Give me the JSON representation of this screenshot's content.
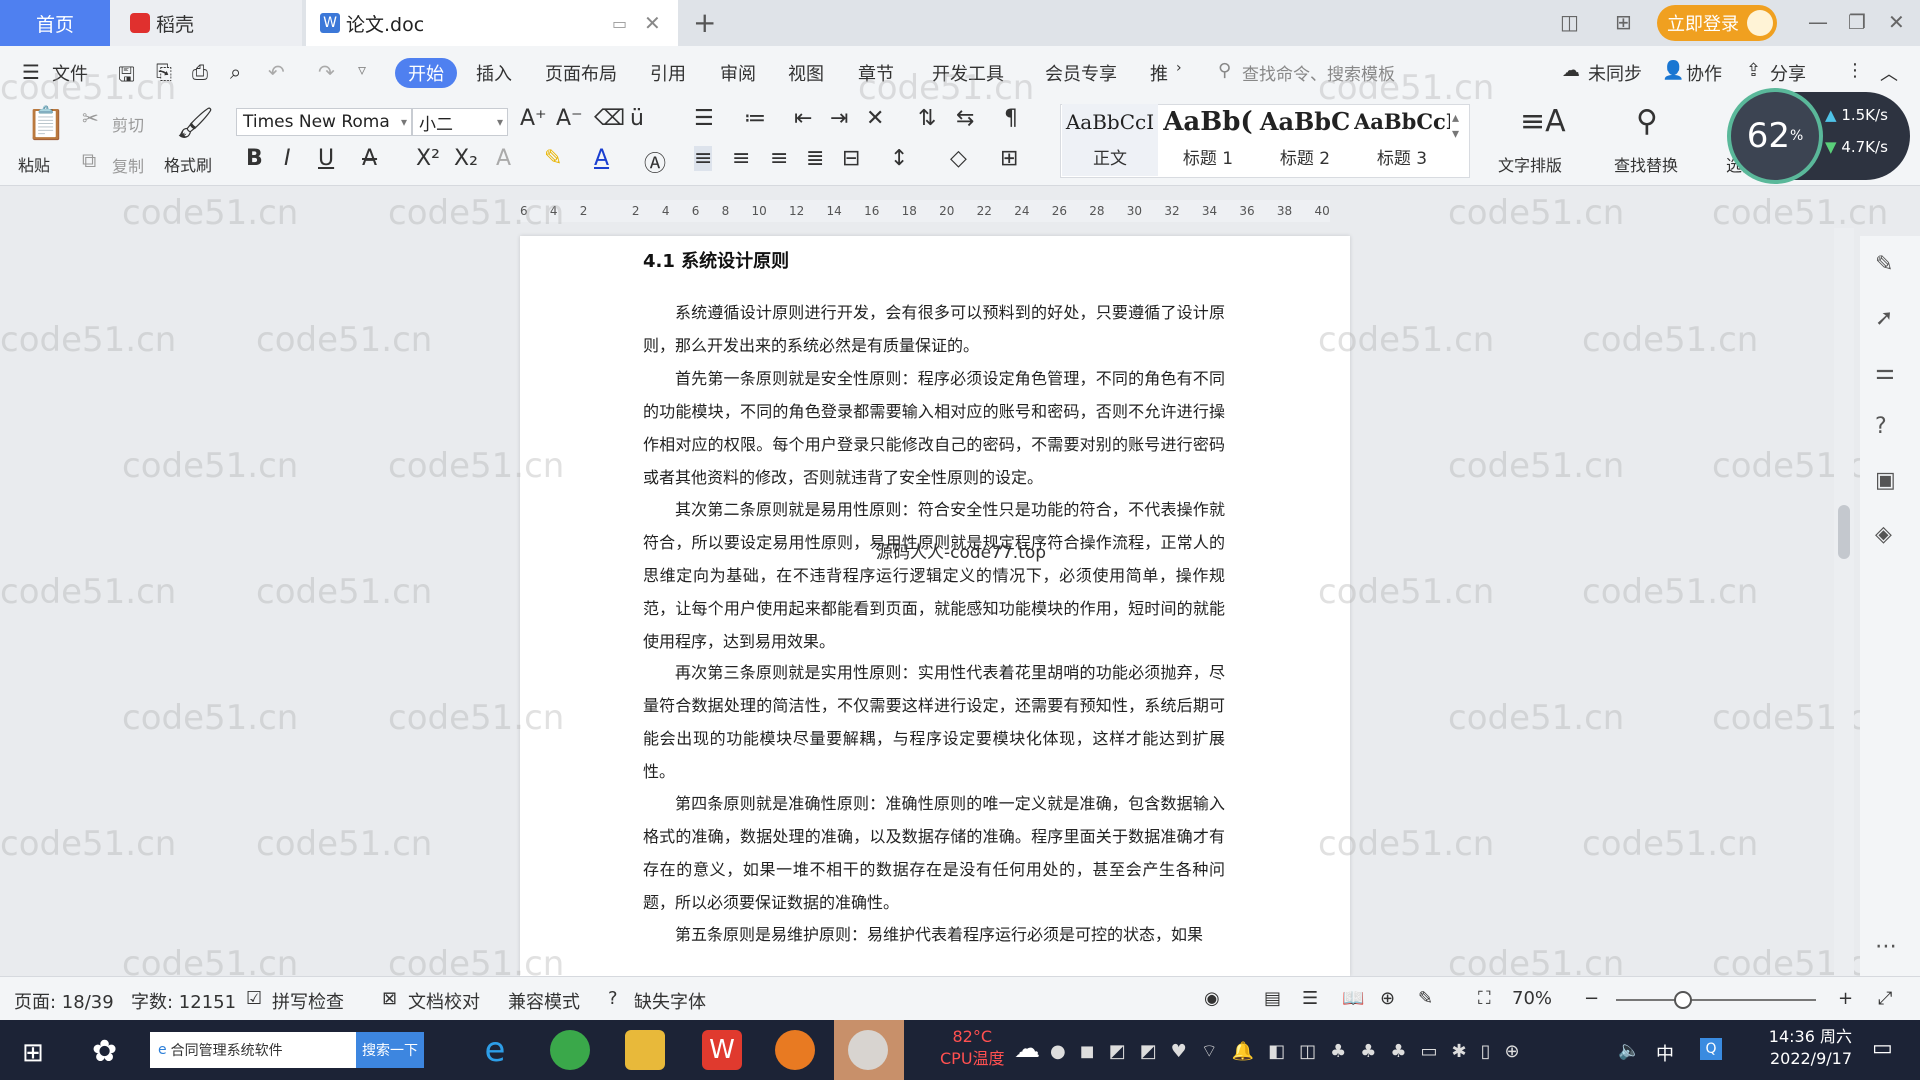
{
  "tabs": {
    "home": "首页",
    "daoke": "稻壳",
    "doc": "论文.doc",
    "new_tab": "+"
  },
  "title_bar": {
    "login": "立即登录"
  },
  "menu": {
    "file": "文件",
    "items": [
      "开始",
      "插入",
      "页面布局",
      "引用",
      "审阅",
      "视图",
      "章节",
      "开发工具",
      "会员专享",
      "推"
    ],
    "search_cmd": "查找命令、搜索模板",
    "sync": "未同步",
    "collab": "协作",
    "share": "分享"
  },
  "toolbar": {
    "paste": "粘贴",
    "cut": "剪切",
    "copy": "复制",
    "format_painter": "格式刷",
    "font_name": "Times New Roma",
    "font_size": "小二",
    "styles": [
      {
        "sample": "AaBbCcI",
        "name": "正文"
      },
      {
        "sample": "AaBb(",
        "name": "标题 1"
      },
      {
        "sample": "AaBbC",
        "name": "标题 2"
      },
      {
        "sample": "AaBbCcI",
        "name": "标题 3"
      }
    ],
    "text_layout": "文字排版",
    "find_replace": "查找替换",
    "select": "选择"
  },
  "speed_widget": {
    "percent": "62",
    "up": "1.5K/s",
    "down": "4.7K/s"
  },
  "ruler_ticks": [
    "6",
    "4",
    "2",
    "",
    "2",
    "4",
    "6",
    "8",
    "10",
    "12",
    "14",
    "16",
    "18",
    "20",
    "22",
    "24",
    "26",
    "28",
    "30",
    "32",
    "34",
    "36",
    "38",
    "40"
  ],
  "document": {
    "heading": "4.1  系统设计原则",
    "paragraphs": [
      "系统遵循设计原则进行开发，会有很多可以预料到的好处，只要遵循了设计原则，那么开发出来的系统必然是有质量保证的。",
      "首先第一条原则就是安全性原则：程序必须设定角色管理，不同的角色有不同的功能模块，不同的角色登录都需要输入相对应的账号和密码，否则不允许进行操作相对应的权限。每个用户登录只能修改自己的密码，不需要对别的账号进行密码或者其他资料的修改，否则就违背了安全性原则的设定。",
      "其次第二条原则就是易用性原则：符合安全性只是功能的符合，不代表操作就符合，所以要设定易用性原则，易用性原则就是规定程序符合操作流程，正常人的思维定向为基础，在不违背程序运行逻辑定义的情况下，必须使用简单，操作规范，让每个用户使用起来都能看到页面，就能感知功能模块的作用，短时间的就能使用程序，达到易用效果。",
      "再次第三条原则就是实用性原则：实用性代表着花里胡哨的功能必须抛弃，尽量符合数据处理的简洁性，不仅需要这样进行设定，还需要有预知性，系统后期可能会出现的功能模块尽量要解耦，与程序设定要模块化体现，这样才能达到扩展性。",
      "第四条原则就是准确性原则：准确性原则的唯一定义就是准确，包含数据输入格式的准确，数据处理的准确，以及数据存储的准确。程序里面关于数据准确才有存在的意义，如果一堆不相干的数据存在是没有任何用处的，甚至会产生各种问题，所以必须要保证数据的准确性。",
      "第五条原则是易维护原则：易维护代表着程序运行必须是可控的状态，如果"
    ],
    "overlay_text": "源码人人-code77.top"
  },
  "watermark": "code51.cn",
  "status": {
    "page": "页面: 18/39",
    "words": "字数: 12151",
    "spell": "拼写检查",
    "proof": "文档校对",
    "compat": "兼容模式",
    "missing_font": "缺失字体",
    "zoom": "70%"
  },
  "taskbar": {
    "app_label": "合同管理系统软件",
    "search_btn": "搜索一下",
    "temp": "82°C",
    "cpu": "CPU温度",
    "ime": "中",
    "time": "14:36 周六",
    "date": "2022/9/17"
  }
}
